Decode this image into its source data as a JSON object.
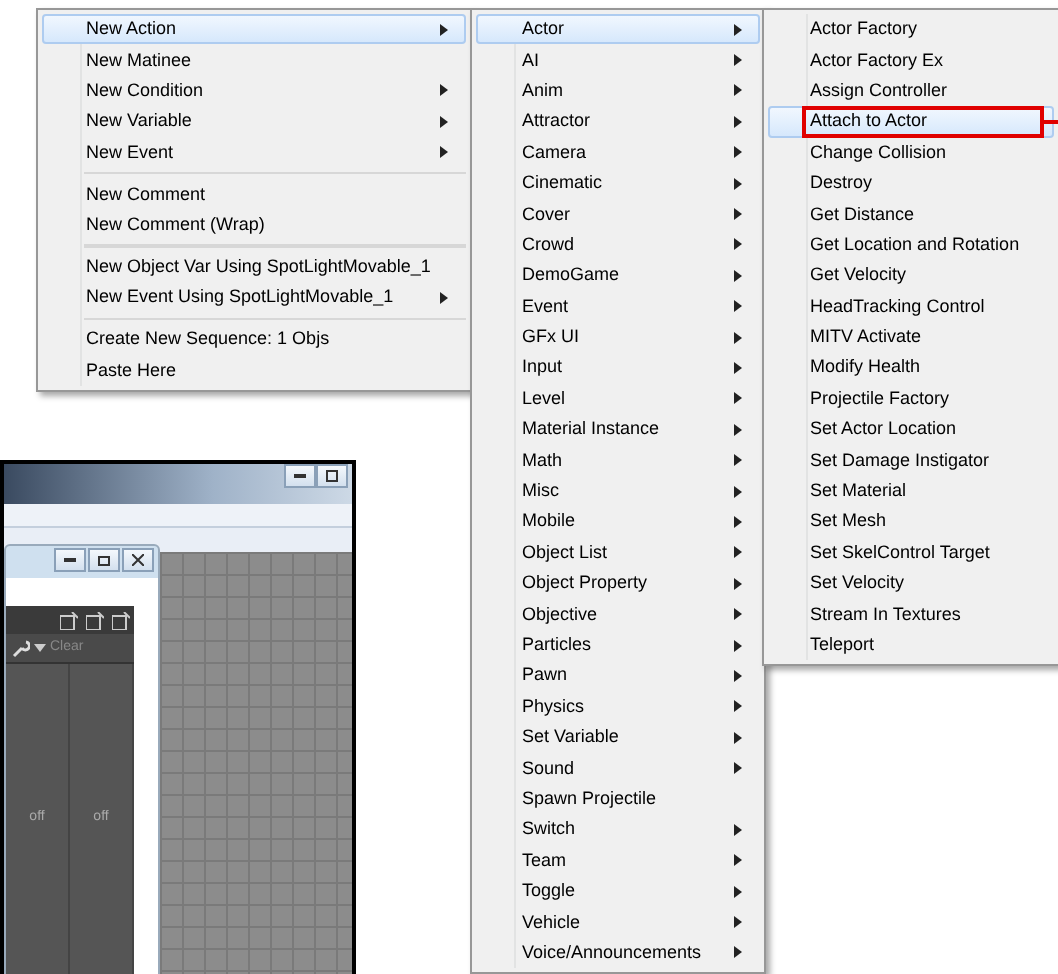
{
  "background_window": {
    "toolbar_button": "Clear",
    "cells": [
      "off",
      "off"
    ]
  },
  "menus": [
    {
      "items": [
        {
          "kind": "item",
          "label": "New Action",
          "has_submenu": true,
          "selected": true,
          "marked": false
        },
        {
          "kind": "item",
          "label": "New Matinee",
          "has_submenu": false,
          "selected": false,
          "marked": false
        },
        {
          "kind": "item",
          "label": "New Condition",
          "has_submenu": true,
          "selected": false,
          "marked": false
        },
        {
          "kind": "item",
          "label": "New Variable",
          "has_submenu": true,
          "selected": false,
          "marked": false
        },
        {
          "kind": "item",
          "label": "New Event",
          "has_submenu": true,
          "selected": false,
          "marked": false
        },
        {
          "kind": "separator"
        },
        {
          "kind": "item",
          "label": "New Comment",
          "has_submenu": false,
          "selected": false,
          "marked": false
        },
        {
          "kind": "item",
          "label": "New Comment (Wrap)",
          "has_submenu": false,
          "selected": false,
          "marked": false
        },
        {
          "kind": "separator"
        },
        {
          "kind": "item",
          "label": "New Object Var Using SpotLightMovable_1",
          "has_submenu": false,
          "selected": false,
          "marked": false
        },
        {
          "kind": "item",
          "label": "New Event Using SpotLightMovable_1",
          "has_submenu": true,
          "selected": false,
          "marked": false
        },
        {
          "kind": "separator"
        },
        {
          "kind": "item",
          "label": "Create New Sequence: 1 Objs",
          "has_submenu": false,
          "selected": false,
          "marked": false
        },
        {
          "kind": "item",
          "label": "Paste Here",
          "has_submenu": false,
          "selected": false,
          "marked": false
        }
      ]
    },
    {
      "items": [
        {
          "kind": "item",
          "label": "Actor",
          "has_submenu": true,
          "selected": true,
          "marked": false
        },
        {
          "kind": "item",
          "label": "AI",
          "has_submenu": true,
          "selected": false,
          "marked": false
        },
        {
          "kind": "item",
          "label": "Anim",
          "has_submenu": true,
          "selected": false,
          "marked": false
        },
        {
          "kind": "item",
          "label": "Attractor",
          "has_submenu": true,
          "selected": false,
          "marked": false
        },
        {
          "kind": "item",
          "label": "Camera",
          "has_submenu": true,
          "selected": false,
          "marked": false
        },
        {
          "kind": "item",
          "label": "Cinematic",
          "has_submenu": true,
          "selected": false,
          "marked": false
        },
        {
          "kind": "item",
          "label": "Cover",
          "has_submenu": true,
          "selected": false,
          "marked": false
        },
        {
          "kind": "item",
          "label": "Crowd",
          "has_submenu": true,
          "selected": false,
          "marked": false
        },
        {
          "kind": "item",
          "label": "DemoGame",
          "has_submenu": true,
          "selected": false,
          "marked": false
        },
        {
          "kind": "item",
          "label": "Event",
          "has_submenu": true,
          "selected": false,
          "marked": false
        },
        {
          "kind": "item",
          "label": "GFx UI",
          "has_submenu": true,
          "selected": false,
          "marked": false
        },
        {
          "kind": "item",
          "label": "Input",
          "has_submenu": true,
          "selected": false,
          "marked": false
        },
        {
          "kind": "item",
          "label": "Level",
          "has_submenu": true,
          "selected": false,
          "marked": false
        },
        {
          "kind": "item",
          "label": "Material Instance",
          "has_submenu": true,
          "selected": false,
          "marked": false
        },
        {
          "kind": "item",
          "label": "Math",
          "has_submenu": true,
          "selected": false,
          "marked": false
        },
        {
          "kind": "item",
          "label": "Misc",
          "has_submenu": true,
          "selected": false,
          "marked": false
        },
        {
          "kind": "item",
          "label": "Mobile",
          "has_submenu": true,
          "selected": false,
          "marked": false
        },
        {
          "kind": "item",
          "label": "Object List",
          "has_submenu": true,
          "selected": false,
          "marked": false
        },
        {
          "kind": "item",
          "label": "Object Property",
          "has_submenu": true,
          "selected": false,
          "marked": false
        },
        {
          "kind": "item",
          "label": "Objective",
          "has_submenu": true,
          "selected": false,
          "marked": false
        },
        {
          "kind": "item",
          "label": "Particles",
          "has_submenu": true,
          "selected": false,
          "marked": false
        },
        {
          "kind": "item",
          "label": "Pawn",
          "has_submenu": true,
          "selected": false,
          "marked": false
        },
        {
          "kind": "item",
          "label": "Physics",
          "has_submenu": true,
          "selected": false,
          "marked": false
        },
        {
          "kind": "item",
          "label": "Set Variable",
          "has_submenu": true,
          "selected": false,
          "marked": false
        },
        {
          "kind": "item",
          "label": "Sound",
          "has_submenu": true,
          "selected": false,
          "marked": false
        },
        {
          "kind": "item",
          "label": "Spawn Projectile",
          "has_submenu": false,
          "selected": false,
          "marked": false
        },
        {
          "kind": "item",
          "label": "Switch",
          "has_submenu": true,
          "selected": false,
          "marked": false
        },
        {
          "kind": "item",
          "label": "Team",
          "has_submenu": true,
          "selected": false,
          "marked": false
        },
        {
          "kind": "item",
          "label": "Toggle",
          "has_submenu": true,
          "selected": false,
          "marked": false
        },
        {
          "kind": "item",
          "label": "Vehicle",
          "has_submenu": true,
          "selected": false,
          "marked": false
        },
        {
          "kind": "item",
          "label": "Voice/Announcements",
          "has_submenu": true,
          "selected": false,
          "marked": false
        }
      ]
    },
    {
      "items": [
        {
          "kind": "item",
          "label": "Actor Factory",
          "has_submenu": false,
          "selected": false,
          "marked": false
        },
        {
          "kind": "item",
          "label": "Actor Factory Ex",
          "has_submenu": false,
          "selected": false,
          "marked": false
        },
        {
          "kind": "item",
          "label": "Assign Controller",
          "has_submenu": false,
          "selected": false,
          "marked": false
        },
        {
          "kind": "item",
          "label": "Attach to Actor",
          "has_submenu": false,
          "selected": true,
          "marked": true
        },
        {
          "kind": "item",
          "label": "Change Collision",
          "has_submenu": false,
          "selected": false,
          "marked": false
        },
        {
          "kind": "item",
          "label": "Destroy",
          "has_submenu": false,
          "selected": false,
          "marked": false
        },
        {
          "kind": "item",
          "label": "Get Distance",
          "has_submenu": false,
          "selected": false,
          "marked": false
        },
        {
          "kind": "item",
          "label": "Get Location and Rotation",
          "has_submenu": false,
          "selected": false,
          "marked": false
        },
        {
          "kind": "item",
          "label": "Get Velocity",
          "has_submenu": false,
          "selected": false,
          "marked": false
        },
        {
          "kind": "item",
          "label": "HeadTracking Control",
          "has_submenu": false,
          "selected": false,
          "marked": false
        },
        {
          "kind": "item",
          "label": "MITV Activate",
          "has_submenu": false,
          "selected": false,
          "marked": false
        },
        {
          "kind": "item",
          "label": "Modify Health",
          "has_submenu": false,
          "selected": false,
          "marked": false
        },
        {
          "kind": "item",
          "label": "Projectile Factory",
          "has_submenu": false,
          "selected": false,
          "marked": false
        },
        {
          "kind": "item",
          "label": "Set Actor Location",
          "has_submenu": false,
          "selected": false,
          "marked": false
        },
        {
          "kind": "item",
          "label": "Set Damage Instigator",
          "has_submenu": false,
          "selected": false,
          "marked": false
        },
        {
          "kind": "item",
          "label": "Set Material",
          "has_submenu": false,
          "selected": false,
          "marked": false
        },
        {
          "kind": "item",
          "label": "Set Mesh",
          "has_submenu": false,
          "selected": false,
          "marked": false
        },
        {
          "kind": "item",
          "label": "Set SkelControl Target",
          "has_submenu": false,
          "selected": false,
          "marked": false
        },
        {
          "kind": "item",
          "label": "Set Velocity",
          "has_submenu": false,
          "selected": false,
          "marked": false
        },
        {
          "kind": "item",
          "label": "Stream In Textures",
          "has_submenu": false,
          "selected": false,
          "marked": false
        },
        {
          "kind": "item",
          "label": "Teleport",
          "has_submenu": false,
          "selected": false,
          "marked": false
        }
      ]
    }
  ]
}
